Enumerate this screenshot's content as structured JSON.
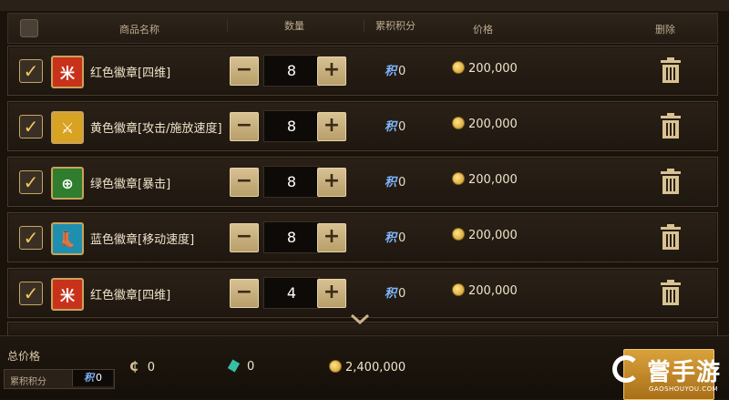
{
  "header": {
    "name": "商品名称",
    "quantity": "数量",
    "points": "累积积分",
    "price": "价格",
    "delete": "删除"
  },
  "rows": [
    {
      "name": "红色徽章[四维]",
      "qty": "8",
      "points": "0",
      "price": "200,000",
      "icon": "red-badge-icon",
      "icon_color": "#c8321b",
      "icon_glyph": "米"
    },
    {
      "name": "黄色徽章[攻击/施放速度]",
      "qty": "8",
      "points": "0",
      "price": "200,000",
      "icon": "yellow-badge-icon",
      "icon_color": "#d8a322",
      "icon_glyph": "⚔"
    },
    {
      "name": "绿色徽章[暴击]",
      "qty": "8",
      "points": "0",
      "price": "200,000",
      "icon": "green-badge-icon",
      "icon_color": "#2f7d2e",
      "icon_glyph": "⊕"
    },
    {
      "name": "蓝色徽章[移动速度]",
      "qty": "8",
      "points": "0",
      "price": "200,000",
      "icon": "blue-badge-icon",
      "icon_color": "#1f8fb0",
      "icon_glyph": "👢"
    },
    {
      "name": "红色徽章[四维]",
      "qty": "4",
      "points": "0",
      "price": "200,000",
      "icon": "red-badge-icon",
      "icon_color": "#c8321b",
      "icon_glyph": "米"
    }
  ],
  "qty_minus": "−",
  "qty_plus": "+",
  "checkmark": "✓",
  "points_icon": "积",
  "footer": {
    "total_label": "总价格",
    "points_label": "累积积分",
    "points_value": "0",
    "currency_c": "0",
    "currency_gem": "0",
    "currency_gold": "2,400,000"
  },
  "watermark": {
    "text": "嘗手游",
    "sub": "GAOSHOUYOU.COM"
  }
}
